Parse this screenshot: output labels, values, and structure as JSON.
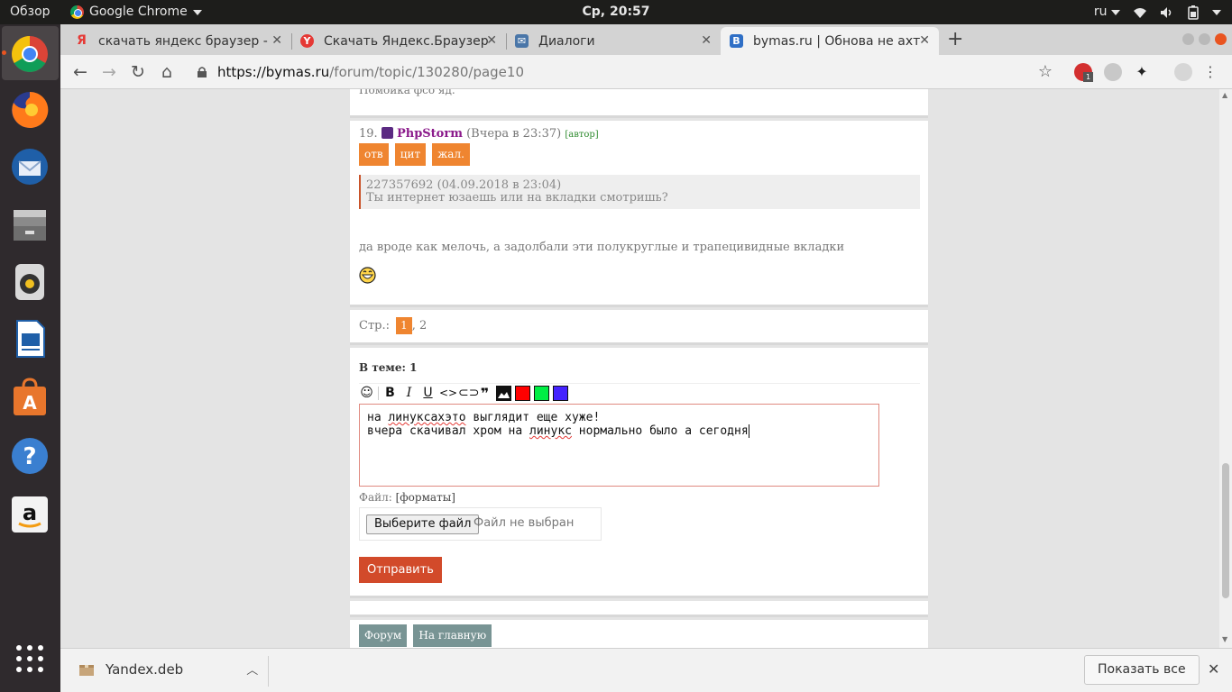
{
  "topbar": {
    "activities": "Обзор",
    "app_name": "Google Chrome",
    "clock": "Ср, 20:57",
    "lang": "ru"
  },
  "dock": {
    "apps": [
      "chrome-icon",
      "firefox-icon",
      "thunderbird-icon",
      "files-icon",
      "rhythmbox-icon",
      "writer-icon",
      "software-center-icon",
      "help-icon",
      "amazon-icon",
      "app-grid-icon"
    ]
  },
  "tabs": [
    {
      "title": "скачать яндекс браузер -",
      "favicon": "Я",
      "color": "#e53935"
    },
    {
      "title": "Скачать Яндекс.Браузер",
      "favicon": "Y",
      "color": "#e53935"
    },
    {
      "title": "Диалоги",
      "favicon": "✉",
      "color": "#4a76a8"
    },
    {
      "title": "bymas.ru | Обнова не ахт",
      "favicon": "B",
      "color": "#2f6fc6"
    }
  ],
  "omnibox": {
    "host": "https://bymas.ru",
    "path": "/forum/topic/130280/page10"
  },
  "extensions": {
    "abp_badge": "1"
  },
  "page": {
    "prev_text": "Помойка фсо яд.",
    "post": {
      "number": "19.",
      "author": "PhpStorm",
      "time": "(Вчера в 23:37)",
      "author_tag": "[автор]",
      "buttons": [
        "отв",
        "цит",
        "жал."
      ],
      "quote_header": "227357692 (04.09.2018 в 23:04)",
      "quote_text": "Ты интернет юзаешь или на вкладки смотришь?",
      "body": "да вроде как мелочь, а задолбали эти полукруглые и трапецивидные вкладки"
    },
    "pager": {
      "label": "Стр.:",
      "current": "1",
      "sep": ",",
      "next": "2"
    },
    "reply": {
      "in_topic_label": "В теме:",
      "in_topic_count": "1",
      "toolbar_icons": [
        "smile-icon",
        "bold-icon",
        "italic-icon",
        "underline-icon",
        "code-icon",
        "link-icon",
        "quote-icon",
        "image-icon"
      ],
      "colors": [
        "#ff0000",
        "#00ee44",
        "#4422ff"
      ],
      "text_line1_a": "на ",
      "text_line1_b": "линуксахэто",
      "text_line1_c": " выглядит еще хуже!",
      "text_line2_a": "вчера скачивал хром на ",
      "text_line2_b": "линукс",
      "text_line2_c": " нормально было а сегодня",
      "file_label": "Файл:",
      "formats": "[форматы]",
      "file_button": "Выберите файл",
      "file_none": "Файл не выбран",
      "send": "Отправить"
    },
    "footer_buttons": [
      "Форум",
      "На главную"
    ]
  },
  "downloads": {
    "file": "Yandex.deb",
    "show_all": "Показать все"
  }
}
